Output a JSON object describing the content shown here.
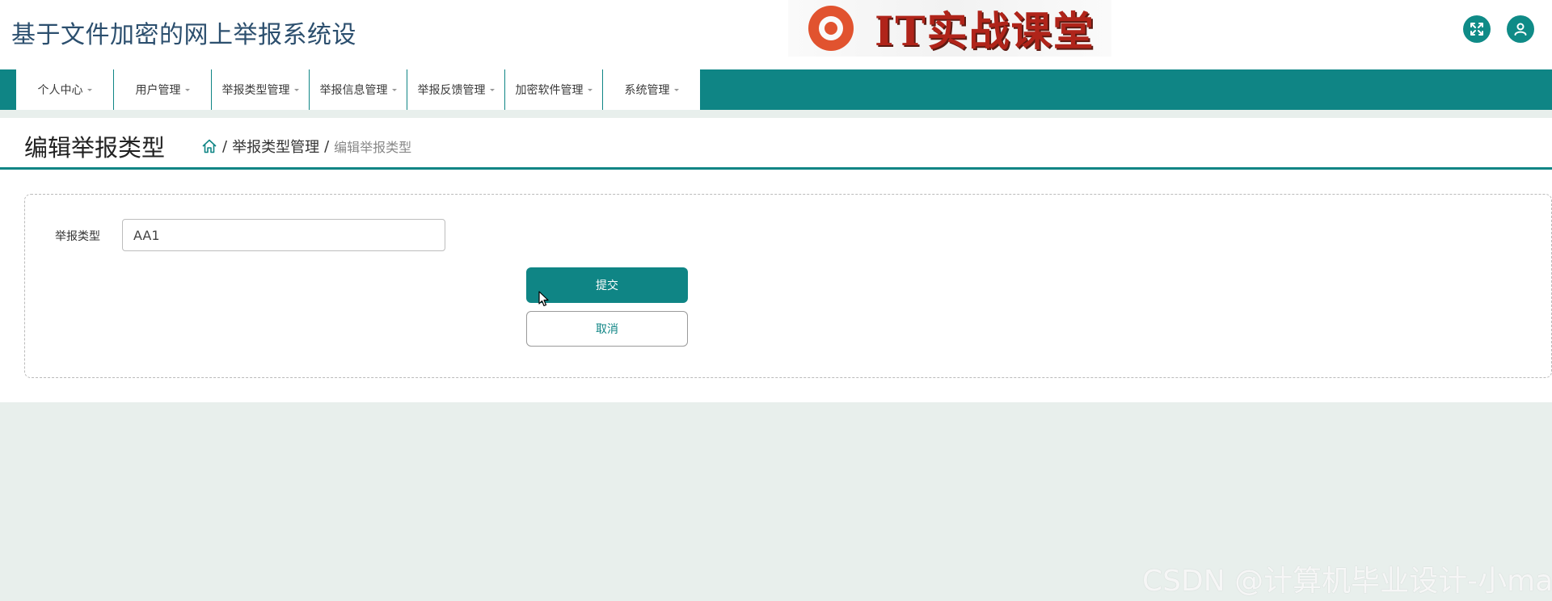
{
  "app": {
    "title": "基于文件加密的网上举报系统设",
    "logo_text": "IT实战课堂"
  },
  "header": {
    "fullscreen_icon": "fullscreen-icon",
    "user_icon": "user-icon"
  },
  "nav": {
    "items": [
      {
        "label": "个人中心"
      },
      {
        "label": "用户管理"
      },
      {
        "label": "举报类型管理"
      },
      {
        "label": "举报信息管理"
      },
      {
        "label": "举报反馈管理"
      },
      {
        "label": "加密软件管理"
      },
      {
        "label": "系统管理"
      }
    ]
  },
  "page": {
    "title": "编辑举报类型",
    "breadcrumb": {
      "home_icon": "home-icon",
      "sep1": "/",
      "level1": "举报类型管理",
      "sep2": "/",
      "current": "编辑举报类型"
    }
  },
  "form": {
    "field_label": "举报类型",
    "field_value": "AA1",
    "submit_label": "提交",
    "cancel_label": "取消"
  },
  "watermark": "CSDN @计算机毕业设计-小ma",
  "colors": {
    "primary": "#0f8585",
    "title": "#2c4f6e",
    "page_bg": "#e8efec"
  }
}
